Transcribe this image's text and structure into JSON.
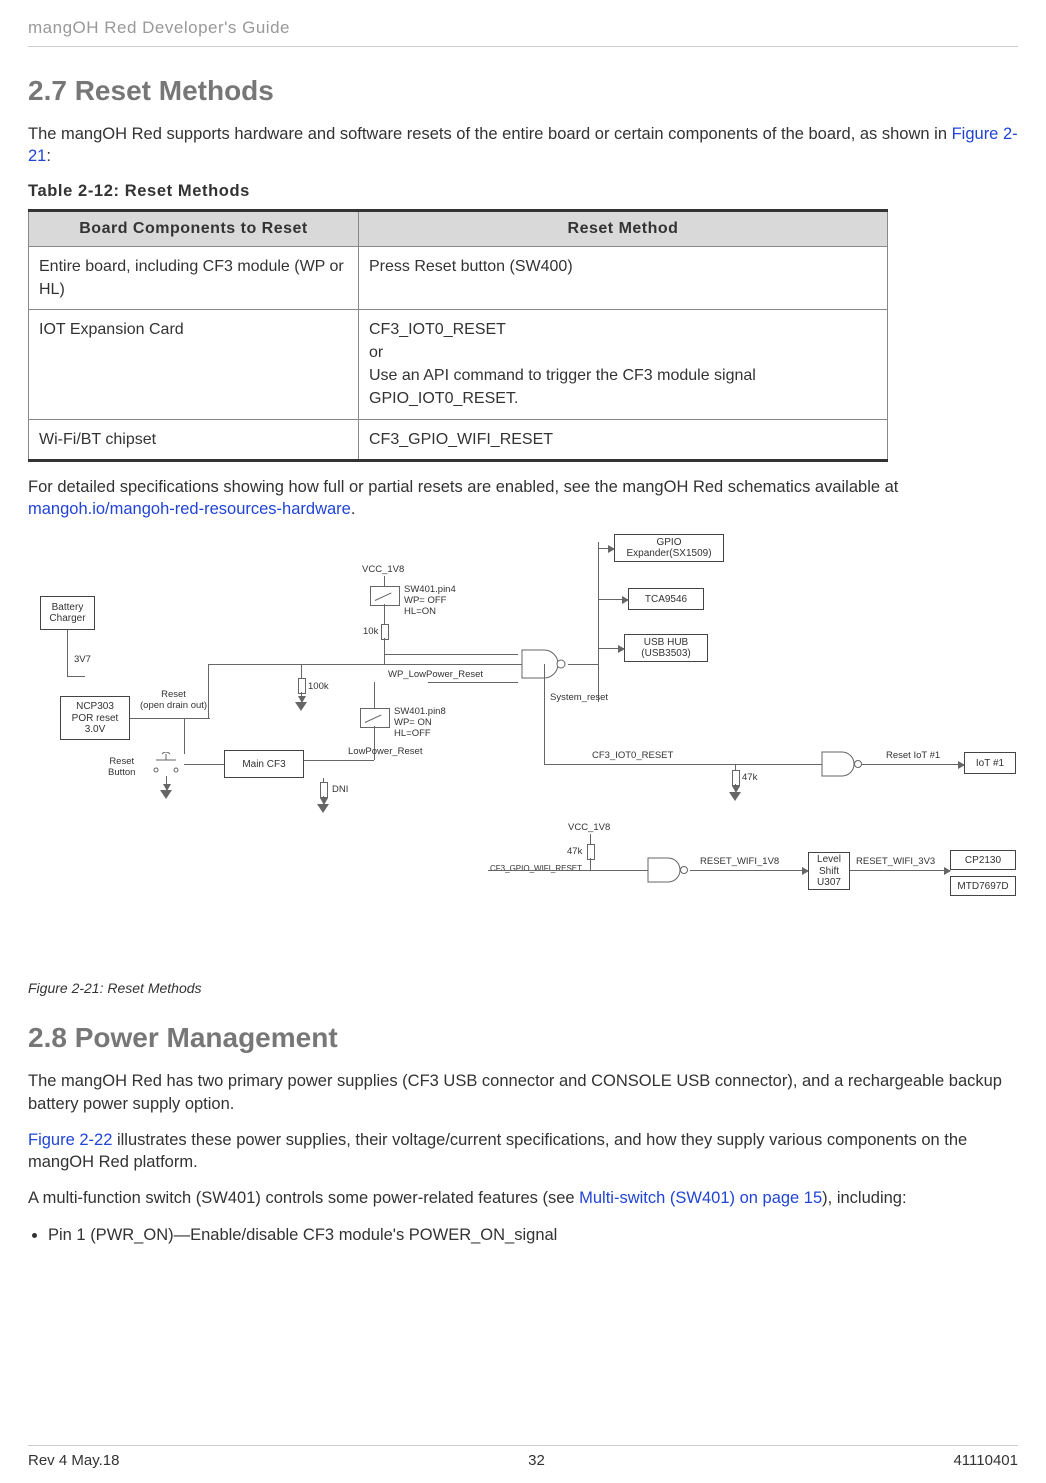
{
  "doc_title": "mangOH Red Developer's Guide",
  "section27": {
    "heading": "2.7 Reset Methods",
    "intro_a": "The mangOH Red supports hardware and software resets of the entire board or certain components of the board, as shown in ",
    "intro_link": "Figure 2-21",
    "intro_b": ":",
    "table_caption": "Table 2-12:  Reset Methods",
    "th1": "Board Components to Reset",
    "th2": "Reset Method",
    "rows": [
      {
        "c1": "Entire board, including CF3 module (WP or HL)",
        "c2": "Press Reset button (SW400)"
      },
      {
        "c1": "IOT Expansion Card",
        "c2": "CF3_IOT0_RESET\nor\nUse an API command to trigger the CF3 module signal GPIO_IOT0_RESET."
      },
      {
        "c1": "Wi-Fi/BT chipset",
        "c2": "CF3_GPIO_WIFI_RESET"
      }
    ],
    "para2_a": "For detailed specifications showing how full or partial resets are enabled, see the mangOH Red schematics available at ",
    "para2_link": "mangoh.io/mangoh-red-resources-hardware",
    "para2_b": "."
  },
  "diagram": {
    "battery_charger": "Battery\nCharger",
    "ncp": "NCP303\nPOR reset\n3.0V",
    "reset_btn": "Reset\nButton",
    "main_cf3": "Main CF3",
    "gpio_exp": "GPIO\nExpander(SX1509)",
    "tca": "TCA9546",
    "usbhub": "USB HUB\n(USB3503)",
    "iot1": "IoT #1",
    "level": "Level\nShift\nU307",
    "cp": "CP2130",
    "mtd": "MTD7697D",
    "lbl_3v7": "3V7",
    "lbl_reset_od": "Reset\n(open drain out)",
    "lbl_vcc1": "VCC_1V8",
    "lbl_vcc2": "VCC_1V8",
    "lbl_sw4": "SW401.pin4\nWP= OFF\nHL=ON",
    "lbl_sw8": "SW401.pin8\nWP= ON\nHL=OFF",
    "lbl_10k": "10k",
    "lbl_100k": "100k",
    "lbl_47k1": "47k",
    "lbl_47k2": "47k",
    "lbl_wp_low": "WP_LowPower_Reset",
    "lbl_low": "LowPower_Reset",
    "lbl_dni": "DNI",
    "lbl_sysreset": "System_reset",
    "lbl_cf3_iot0": "CF3_IOT0_RESET",
    "lbl_reset_iot1": "Reset IoT #1",
    "lbl_reset_wifi18": "RESET_WIFI_1V8",
    "lbl_reset_wifi33": "RESET_WIFI_3V3",
    "lbl_cf3_gpio_wifi": "CF3_GPIO_WIFI_RESET"
  },
  "fig_caption": "Figure 2-21:  Reset Methods",
  "section28": {
    "heading": "2.8 Power Management",
    "p1": "The mangOH Red has two primary power supplies (CF3 USB connector and CONSOLE USB connector), and a rechargeable backup battery power supply option.",
    "p2_a_link": "Figure 2-22",
    "p2_b": " illustrates these power supplies, their voltage/current specifications, and how they supply various components on the mangOH Red platform.",
    "p3_a": "A multi-function switch (SW401) controls some power-related features (see ",
    "p3_link": "Multi-switch (SW401) on page 15",
    "p3_b": "), including:",
    "bullet1": "Pin 1 (PWR_ON)—Enable/disable CF3 module's POWER_ON_signal"
  },
  "footer": {
    "left": "Rev 4  May.18",
    "center": "32",
    "right": "41110401"
  }
}
